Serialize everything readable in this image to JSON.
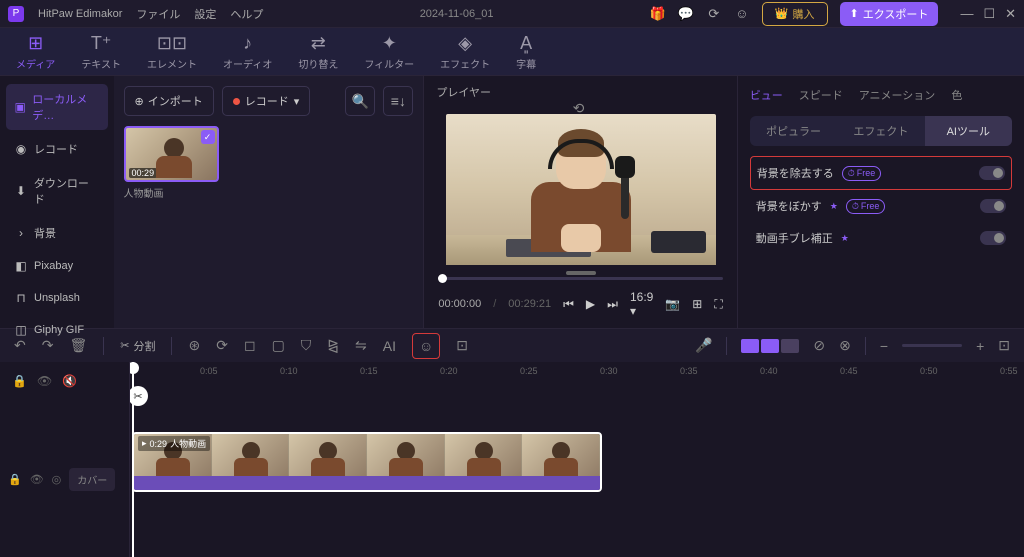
{
  "titlebar": {
    "app_name": "HitPaw Edimakor",
    "menu": {
      "file": "ファイル",
      "settings": "設定",
      "help": "ヘルプ"
    },
    "project_name": "2024-11-06_01",
    "buy_label": "購入",
    "export_label": "エクスポート"
  },
  "toolbar": {
    "media": "メディア",
    "text": "テキスト",
    "element": "エレメント",
    "audio": "オーディオ",
    "transition": "切り替え",
    "filter": "フィルター",
    "effect": "エフェクト",
    "subtitle": "字幕"
  },
  "sidebar": {
    "local": "ローカルメデ…",
    "record": "レコード",
    "download": "ダウンロード",
    "background": "背景",
    "pixabay": "Pixabay",
    "unsplash": "Unsplash",
    "giphy": "Giphy GIF"
  },
  "media": {
    "import_label": "インポート",
    "record_label": "レコード",
    "thumb": {
      "duration": "00:29",
      "name": "人物動画"
    }
  },
  "player": {
    "title": "プレイヤー",
    "current_time": "00:00:00",
    "total_time": "00:29:21",
    "aspect": "16:9"
  },
  "rightpanel": {
    "tabs": {
      "view": "ビュー",
      "speed": "スピード",
      "animation": "アニメーション",
      "color": "色"
    },
    "subtabs": {
      "popular": "ポピュラー",
      "effect": "エフェクト",
      "ai": "AIツール"
    },
    "items": {
      "remove_bg": "背景を除去する",
      "blur_bg": "背景をぼかす",
      "stabilize": "動画手ブレ補正",
      "free_badge": "Free"
    }
  },
  "timeline_bar": {
    "split": "分割"
  },
  "timeline": {
    "track_cover": "カバー",
    "ticks": [
      "0:05",
      "0:10",
      "0:15",
      "0:20",
      "0:25",
      "0:30",
      "0:35",
      "0:40",
      "0:45",
      "0:50",
      "0:55"
    ],
    "clip": {
      "duration": "0:29",
      "name": "人物動画"
    }
  }
}
